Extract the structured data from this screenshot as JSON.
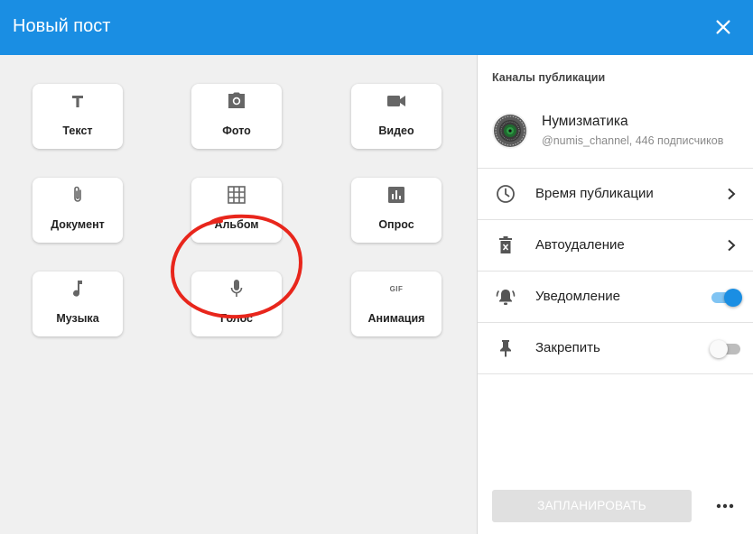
{
  "header": {
    "title": "Новый пост",
    "bg_color": "#1a8ee3"
  },
  "tiles": [
    {
      "label": "Текст",
      "icon": "text-icon"
    },
    {
      "label": "Фото",
      "icon": "camera-icon"
    },
    {
      "label": "Видео",
      "icon": "video-camera-icon"
    },
    {
      "label": "Документ",
      "icon": "paperclip-icon"
    },
    {
      "label": "Альбом",
      "icon": "grid-icon"
    },
    {
      "label": "Опрос",
      "icon": "poll-chart-icon"
    },
    {
      "label": "Музыка",
      "icon": "music-note-icon"
    },
    {
      "label": "Голос",
      "icon": "microphone-icon"
    },
    {
      "label": "Анимация",
      "icon": "gif-icon",
      "icon_text": "GIF"
    }
  ],
  "annotation_color": "#e8261c",
  "right_panel": {
    "section_title": "Каналы публикации",
    "channel": {
      "name": "Нумизматика",
      "subtitle": "@numis_channel, 446 подписчиков"
    },
    "rows": [
      {
        "label": "Время публикации",
        "icon": "clock-icon",
        "control": "chevron"
      },
      {
        "label": "Автоудаление",
        "icon": "delete-timer-icon",
        "control": "chevron"
      },
      {
        "label": "Уведомление",
        "icon": "bell-ring-icon",
        "control": "toggle",
        "on": true
      },
      {
        "label": "Закрепить",
        "icon": "pin-icon",
        "control": "toggle",
        "on": false
      }
    ],
    "schedule_button": "ЗАПЛАНИРОВАТЬ",
    "more_icon": "more-horizontal-icon"
  }
}
